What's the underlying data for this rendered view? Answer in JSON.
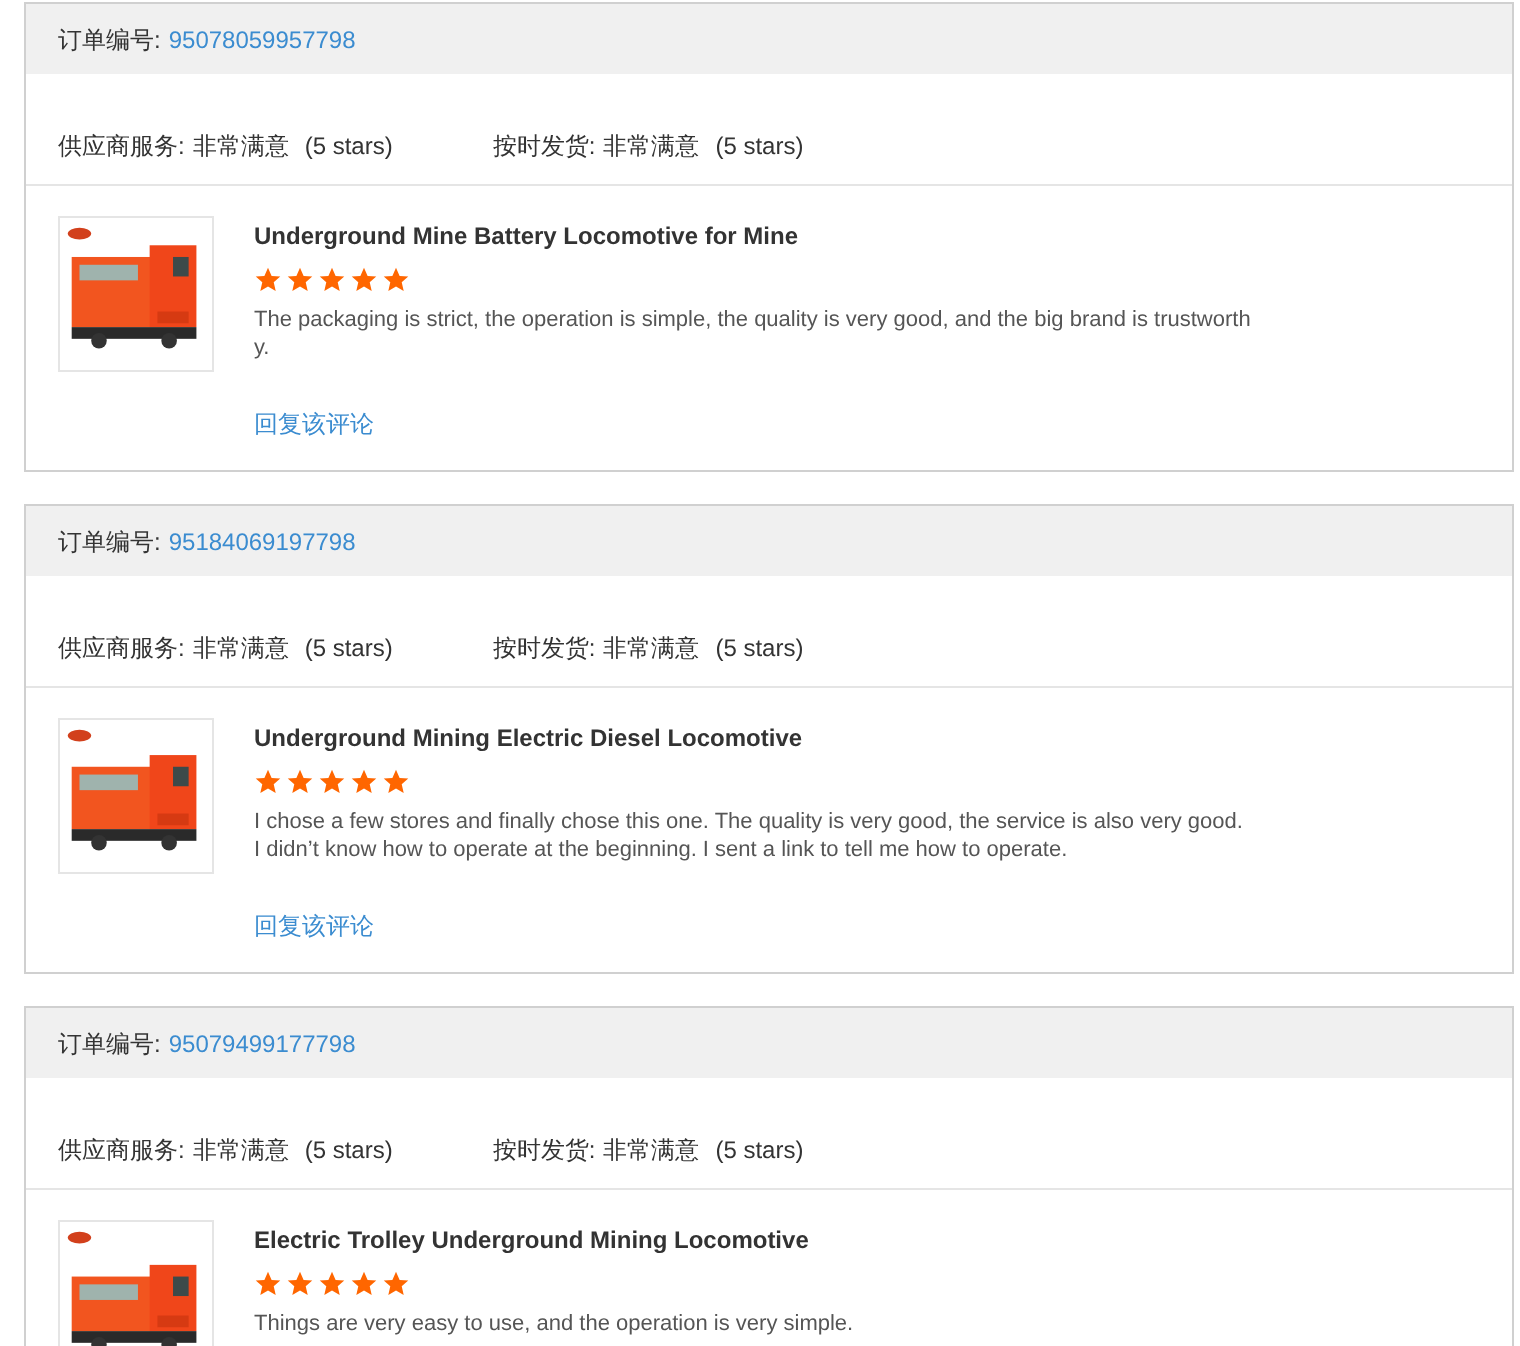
{
  "orders": [
    {
      "order_label": "订单编号:",
      "order_number": "95078059957798",
      "service_label": "供应商服务:",
      "service_value": "非常满意",
      "service_stars": "(5 stars)",
      "shipping_label": "按时发货:",
      "shipping_value": "非常满意",
      "shipping_stars": "(5 stars)",
      "product_title": "Underground Mine Battery Locomotive for Mine",
      "stars": 5,
      "comment": "The packaging is strict, the operation is simple, the quality is very good, and the big brand is trustworthy.",
      "reply_link": "回复该评论"
    },
    {
      "order_label": "订单编号:",
      "order_number": "95184069197798",
      "service_label": "供应商服务:",
      "service_value": "非常满意",
      "service_stars": "(5 stars)",
      "shipping_label": "按时发货:",
      "shipping_value": "非常满意",
      "shipping_stars": "(5 stars)",
      "product_title": "Underground Mining Electric Diesel Locomotive",
      "stars": 5,
      "comment": "I chose a few stores and finally chose this one. The quality is very good, the service is also very good. I didn’t know how to operate at the beginning. I sent a link to tell me how to operate.",
      "reply_link": "回复该评论"
    },
    {
      "order_label": "订单编号:",
      "order_number": "95079499177798",
      "service_label": "供应商服务:",
      "service_value": "非常满意",
      "service_stars": "(5 stars)",
      "shipping_label": "按时发货:",
      "shipping_value": "非常满意",
      "shipping_stars": "(5 stars)",
      "product_title": "Electric Trolley Underground Mining Locomotive",
      "stars": 5,
      "comment": "Things are very easy to use, and the operation is very simple."
    }
  ]
}
